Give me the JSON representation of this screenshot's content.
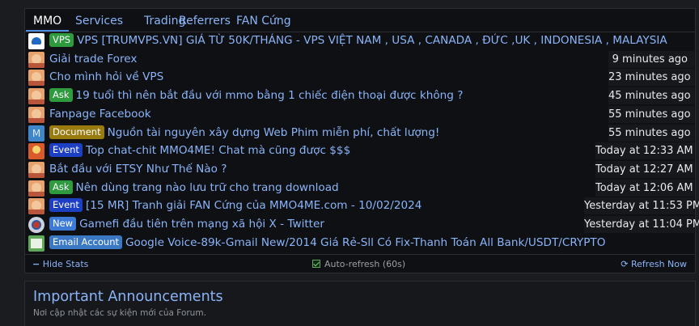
{
  "tabs": [
    "MMO",
    "Services",
    "Trading",
    "Referrers",
    "FAN Cứng"
  ],
  "threads": [
    {
      "avatar": "vps-logo",
      "badge": {
        "label": "VPS",
        "color": "#2e9b3f"
      },
      "title": "VPS [TRUMVPS.VN] GIÁ TỪ 50K/THÁNG - VPS VIỆT NAM , USA , CANADA , ĐỨC ,UK , INDONESIA , MALAYSIA",
      "time": ""
    },
    {
      "avatar": "face",
      "badge": null,
      "title": "Giải trade Forex",
      "time": "9 minutes ago"
    },
    {
      "avatar": "face",
      "badge": null,
      "title": "Cho mình hỏi về VPS",
      "time": "23 minutes ago"
    },
    {
      "avatar": "face",
      "badge": {
        "label": "Ask",
        "color": "#2e9b3f"
      },
      "title": "19 tuổi thì nên bắt đầu với mmo bằng 1 chiếc điện thoại được không ?",
      "time": "45 minutes ago"
    },
    {
      "avatar": "face",
      "badge": null,
      "title": "Fanpage Facebook",
      "time": "55 minutes ago"
    },
    {
      "avatar": "letter-m",
      "badge": {
        "label": "Document",
        "color": "#9a7b10"
      },
      "title": "Nguồn tài nguyên xây dựng Web Phim miễn phí, chất lượng!",
      "time": "55 minutes ago"
    },
    {
      "avatar": "red",
      "badge": {
        "label": "Event",
        "color": "#1d3fc4"
      },
      "title": "Top chat-chit MMO4ME! Chat mà cũng được $$$",
      "time": "Today at 12:33 AM"
    },
    {
      "avatar": "face",
      "badge": null,
      "title": "Bắt đầu với ETSY Như Thế Nào ?",
      "time": "Today at 12:27 AM"
    },
    {
      "avatar": "face",
      "badge": {
        "label": "Ask",
        "color": "#2e9b3f"
      },
      "title": "Nên dùng trang nào lưu trữ cho trang download",
      "time": "Today at 12:06 AM"
    },
    {
      "avatar": "face",
      "badge": {
        "label": "Event",
        "color": "#1d3fc4"
      },
      "title": "[15 MR] Tranh giải FAN Cứng của MMO4ME.com - 10/02/2024",
      "time": "Yesterday at 11:53 PM"
    },
    {
      "avatar": "ring",
      "badge": {
        "label": "New",
        "color": "#3d7ad6"
      },
      "title": "Gamefi đầu tiên trên mạng xã hội X - Twitter",
      "time": "Yesterday at 11:04 PM"
    },
    {
      "avatar": "green",
      "badge": {
        "label": "Email Account",
        "color": "#3a78c4"
      },
      "title": "Google Voice-89k-Gmail New/2014 Giá Rẻ-Sll Có Fix-Thanh Toán All Bank/USDT/CRYPTO",
      "time": ""
    }
  ],
  "footer": {
    "hide_stats": "Hide Stats",
    "auto_refresh": "Auto-refresh (60s)",
    "refresh_now": "Refresh Now"
  },
  "announcements": {
    "title": "Important Announcements",
    "subtitle": "Nơi cập nhật các sự kiện mới của Forum."
  },
  "colors": {
    "link": "#8ab4f8",
    "panel_bg": "#0f1013",
    "page_bg": "#1b1c1f"
  }
}
